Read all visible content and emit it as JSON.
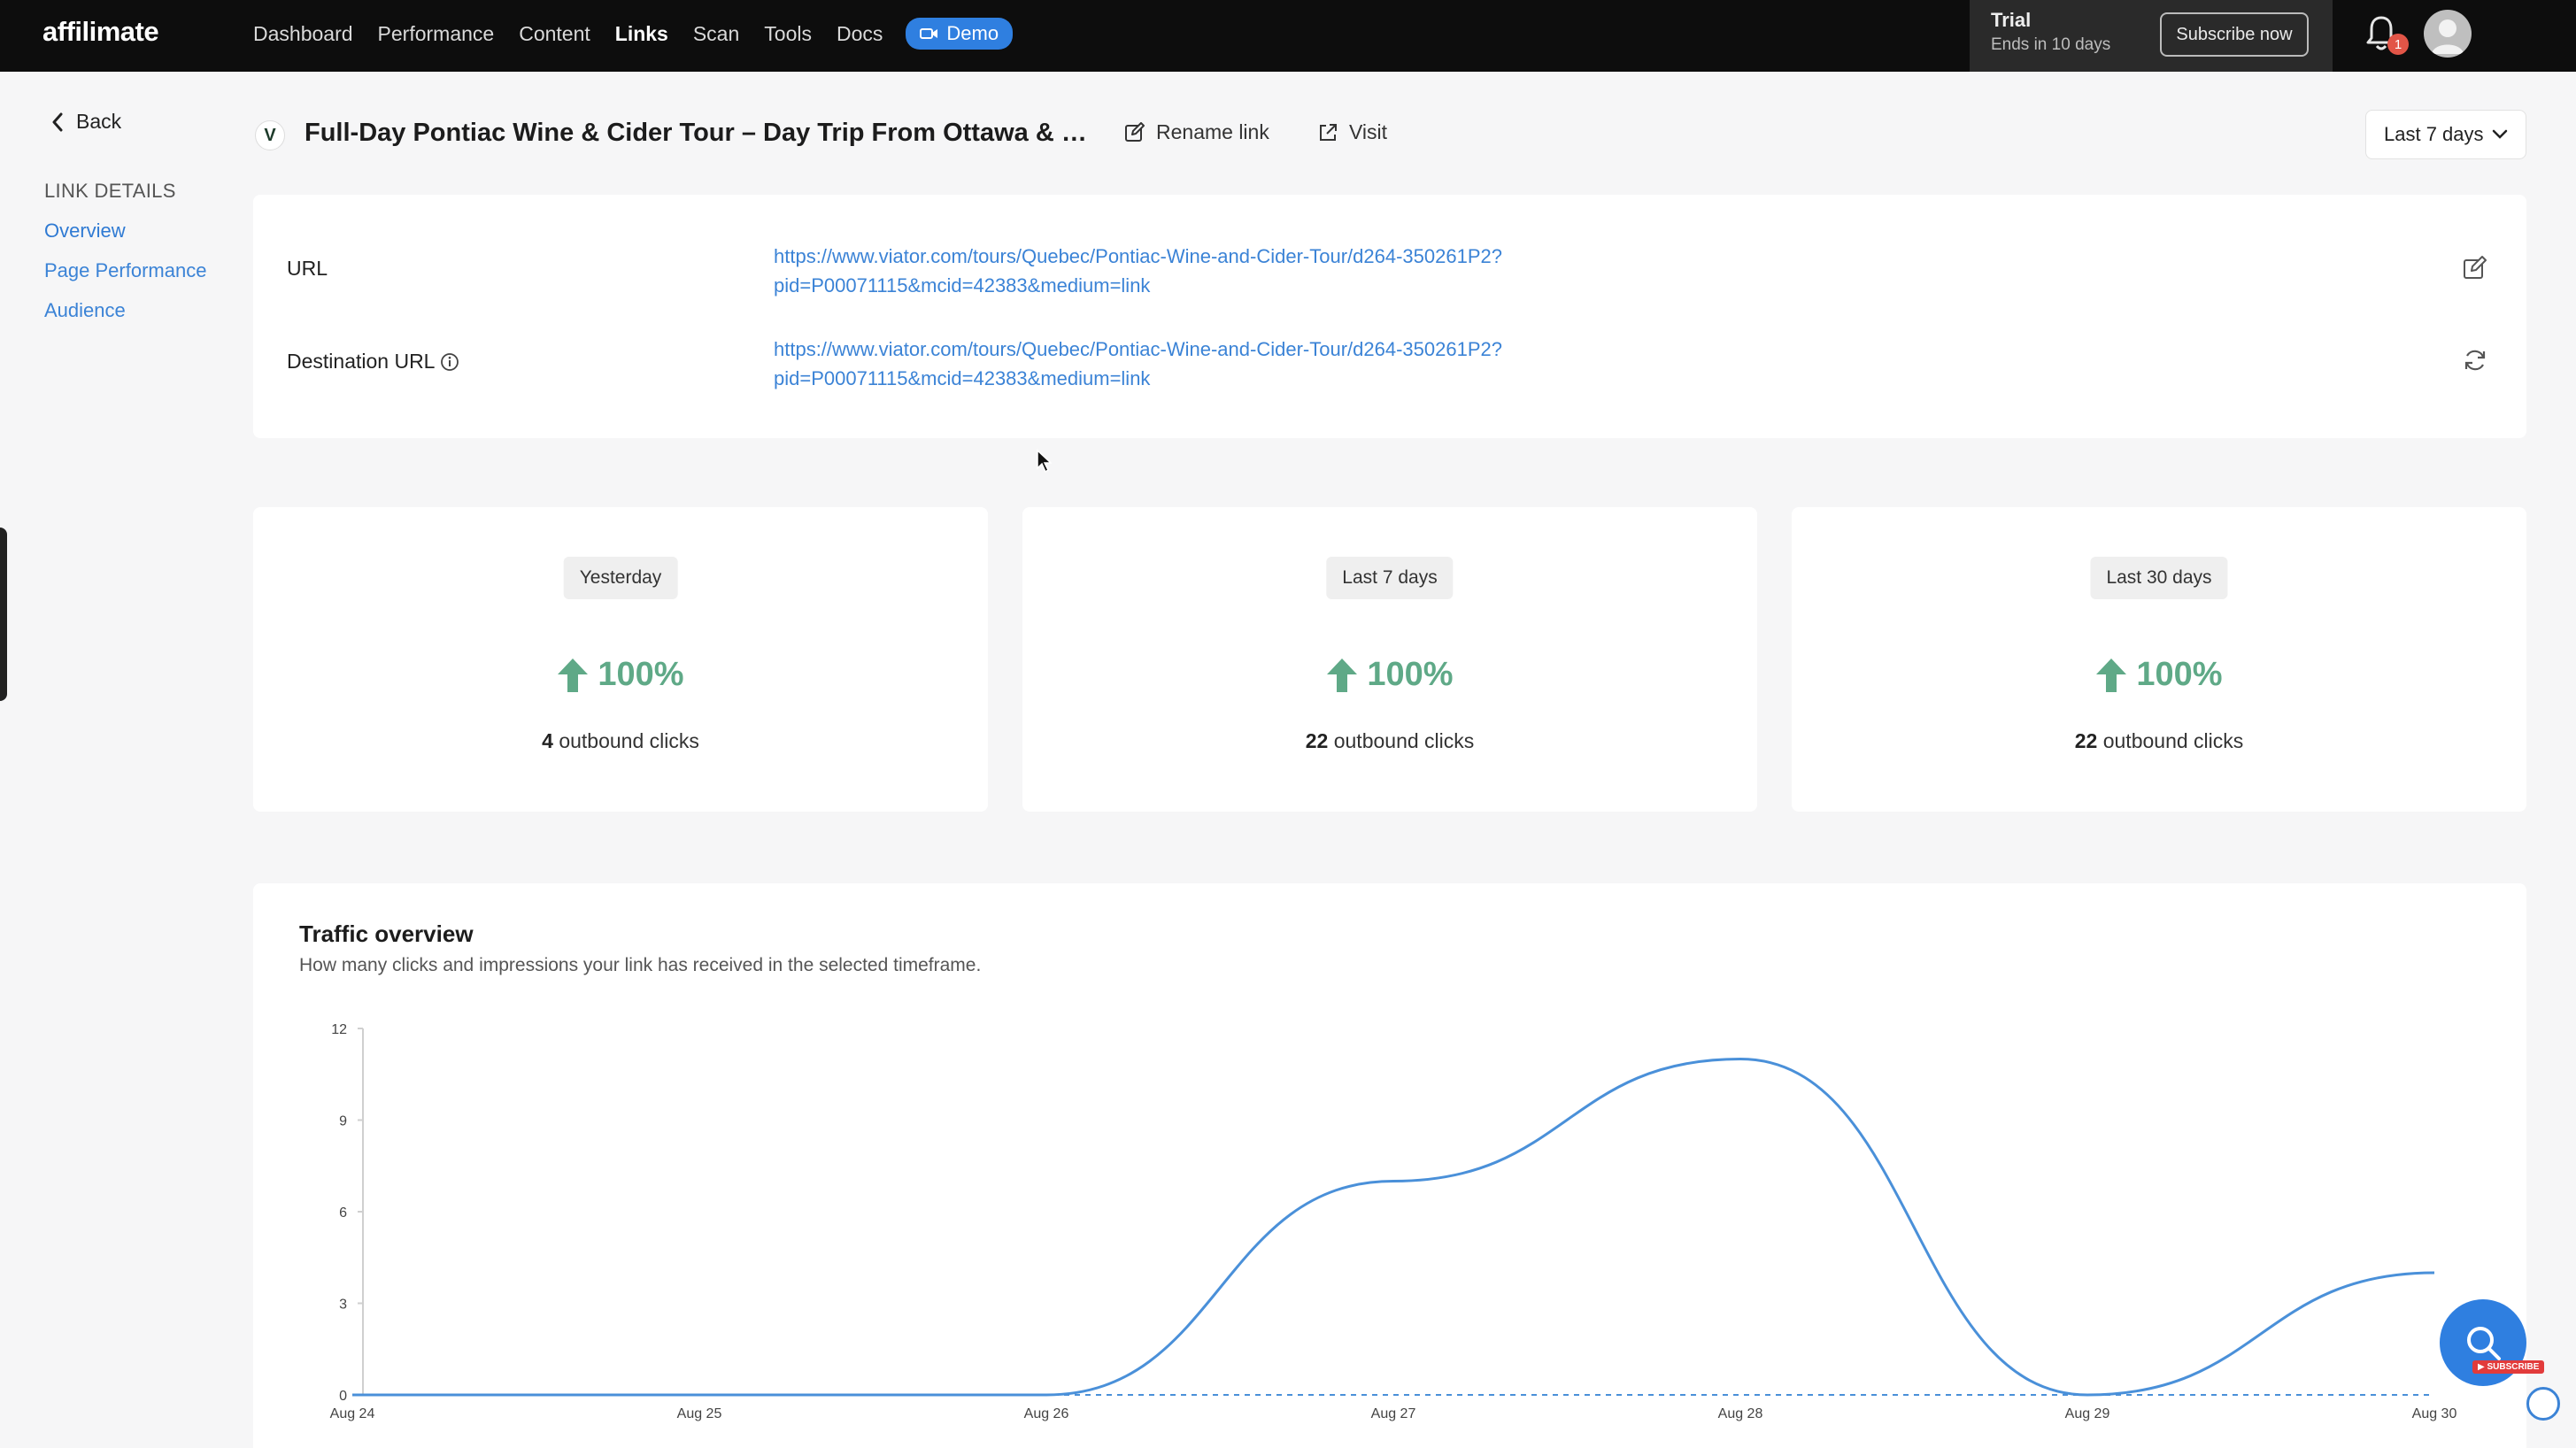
{
  "app": {
    "logo": "affilimate",
    "nav": [
      {
        "label": "Dashboard",
        "active": false
      },
      {
        "label": "Performance",
        "active": false
      },
      {
        "label": "Content",
        "active": false
      },
      {
        "label": "Links",
        "active": true
      },
      {
        "label": "Scan",
        "active": false
      },
      {
        "label": "Tools",
        "active": false
      },
      {
        "label": "Docs",
        "active": false
      }
    ],
    "demo_label": "Demo",
    "trial": {
      "title": "Trial",
      "subtitle": "Ends in 10 days",
      "subscribe_label": "Subscribe now"
    },
    "notifications_count": "1",
    "accent": "#2f7fe0"
  },
  "sidebar": {
    "back_label": "Back",
    "heading": "LINK DETAILS",
    "items": [
      {
        "label": "Overview",
        "active": true
      },
      {
        "label": "Page Performance",
        "active": false
      },
      {
        "label": "Audience",
        "active": false
      }
    ]
  },
  "header": {
    "title": "Full-Day Pontiac Wine & Cider Tour – Day Trip From Ottawa & Gati...",
    "rename_label": "Rename link",
    "visit_label": "Visit",
    "range_label": "Last 7 days"
  },
  "link": {
    "url_label": "URL",
    "url_line1": "https://www.viator.com/tours/Quebec/Pontiac-Wine-and-Cider-Tour/d264-350261P2?",
    "url_line2": "pid=P00071115&mcid=42383&medium=link",
    "dest_label": "Destination URL",
    "dest_line1": "https://www.viator.com/tours/Quebec/Pontiac-Wine-and-Cider-Tour/d264-350261P2?",
    "dest_line2": "pid=P00071115&mcid=42383&medium=link"
  },
  "stats": [
    {
      "period": "Yesterday",
      "change": "100%",
      "count": "4",
      "unit": "outbound clicks"
    },
    {
      "period": "Last 7 days",
      "change": "100%",
      "count": "22",
      "unit": "outbound clicks"
    },
    {
      "period": "Last 30 days",
      "change": "100%",
      "count": "22",
      "unit": "outbound clicks"
    }
  ],
  "traffic": {
    "title": "Traffic overview",
    "subtitle": "How many clicks and impressions your link has received in the selected timeframe."
  },
  "chart_data": {
    "type": "line",
    "categories": [
      "Aug 24",
      "Aug 25",
      "Aug 26",
      "Aug 27",
      "Aug 28",
      "Aug 29",
      "Aug 30"
    ],
    "x": [
      "Aug 24",
      "Aug 25",
      "Aug 26",
      "Aug 27",
      "Aug 28",
      "Aug 29",
      "Aug 30"
    ],
    "series": [
      {
        "values": [
          0,
          0,
          0,
          7,
          11,
          0,
          4
        ],
        "color": "#4a90d9"
      }
    ],
    "baseline_series": {
      "values": [
        0,
        0,
        0,
        0,
        0,
        0,
        0
      ],
      "color": "#4a90d9",
      "style": "dashed"
    },
    "yticks": [
      0,
      3,
      6,
      9,
      12
    ],
    "ylim": [
      0,
      12
    ],
    "grid": false,
    "legend": "none"
  }
}
